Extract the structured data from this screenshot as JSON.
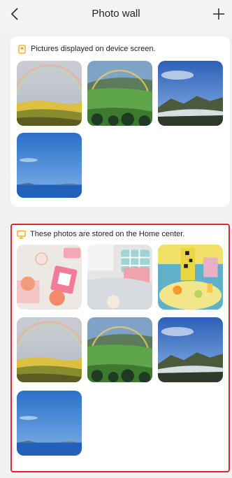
{
  "header": {
    "title": "Photo wall",
    "back_icon": "chevron-left-icon",
    "add_icon": "plus-icon"
  },
  "device_section": {
    "label": "Pictures displayed on device screen.",
    "icon": "frame-icon",
    "icon_color": "#f0a40a",
    "photos": [
      "rainbow-hills",
      "rainbow-meadow",
      "mountain-ridge",
      "blue-sky-sea"
    ]
  },
  "home_section": {
    "label": "These photos are stored on the Home center.",
    "icon": "monitor-icon",
    "icon_color": "#f0a40a",
    "highlight_color": "#e0282e",
    "photos": [
      "peaches-still-life",
      "bedroom-pillows",
      "yellow-toy-scene",
      "rainbow-hills",
      "rainbow-meadow",
      "mountain-ridge",
      "blue-sky-sea"
    ]
  }
}
